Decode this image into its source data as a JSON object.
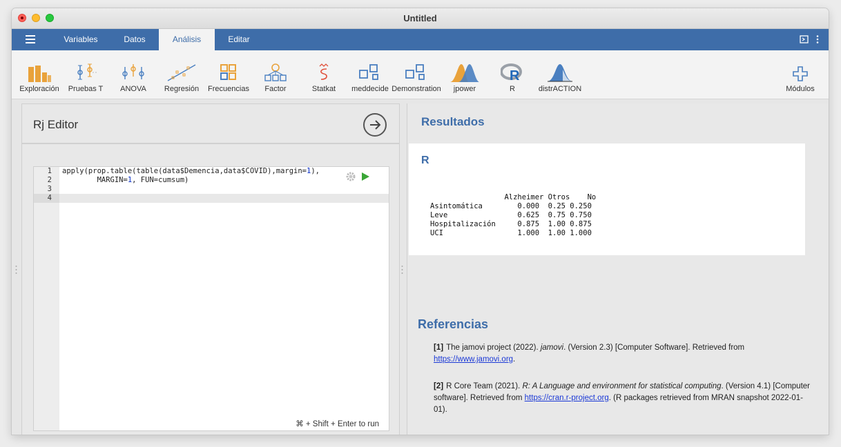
{
  "window": {
    "title": "Untitled"
  },
  "menu": {
    "tabs": [
      {
        "label": "Variables",
        "active": false
      },
      {
        "label": "Datos",
        "active": false
      },
      {
        "label": "Análisis",
        "active": true
      },
      {
        "label": "Editar",
        "active": false
      }
    ]
  },
  "toolbar": {
    "items": [
      {
        "label": "Exploración",
        "icon": "exploration-bars-icon"
      },
      {
        "label": "Pruebas T",
        "icon": "t-tests-icon"
      },
      {
        "label": "ANOVA",
        "icon": "anova-icon"
      },
      {
        "label": "Regresión",
        "icon": "regression-icon"
      },
      {
        "label": "Frecuencias",
        "icon": "frequencies-icon"
      },
      {
        "label": "Factor",
        "icon": "factor-icon"
      },
      {
        "label": "Statkat",
        "icon": "statkat-icon"
      },
      {
        "label": "meddecide",
        "icon": "meddecide-icon"
      },
      {
        "label": "Demonstration",
        "icon": "demonstration-icon"
      },
      {
        "label": "jpower",
        "icon": "jpower-icon"
      },
      {
        "label": "R",
        "icon": "r-logo-icon"
      },
      {
        "label": "distrACTION",
        "icon": "distraction-icon"
      }
    ],
    "modules_label": "Módulos"
  },
  "editor": {
    "title": "Rj Editor",
    "line_numbers": [
      "1",
      "2",
      "3",
      "4"
    ],
    "code_line1_a": "apply(prop.table(table(data$Demencia,data$COVID),margin=",
    "code_line1_num": "1",
    "code_line1_b": "),",
    "code_line2_a": "        MARGIN=",
    "code_line2_num": "1",
    "code_line2_b": ", FUN=cumsum)",
    "run_hint": "⌘ + Shift + Enter to run"
  },
  "results": {
    "title": "Resultados",
    "r_heading": "R",
    "output": "                 Alzheimer Otros    No\nAsintomática        0.000  0.25 0.250\nLeve                0.625  0.75 0.750\nHospitalización     0.875  1.00 0.875\nUCI                 1.000  1.00 1.000"
  },
  "references": {
    "title": "Referencias",
    "items": [
      {
        "num": "[1]",
        "pre": "The jamovi project (2022). ",
        "em": "jamovi",
        "post": ". (Version 2.3) [Computer Software]. Retrieved from ",
        "link": "https://www.jamovi.org",
        "tail": "."
      },
      {
        "num": "[2]",
        "pre": "R Core Team (2021). ",
        "em": "R: A Language and environment for statistical computing",
        "post": ". (Version 4.1) [Computer software]. Retrieved from ",
        "link": "https://cran.r-project.org",
        "tail": ". (R packages retrieved from MRAN snapshot 2022-01-01)."
      }
    ]
  },
  "colors": {
    "accent": "#3e6da9",
    "link": "#1a38d6",
    "run_green": "#3aa637"
  }
}
